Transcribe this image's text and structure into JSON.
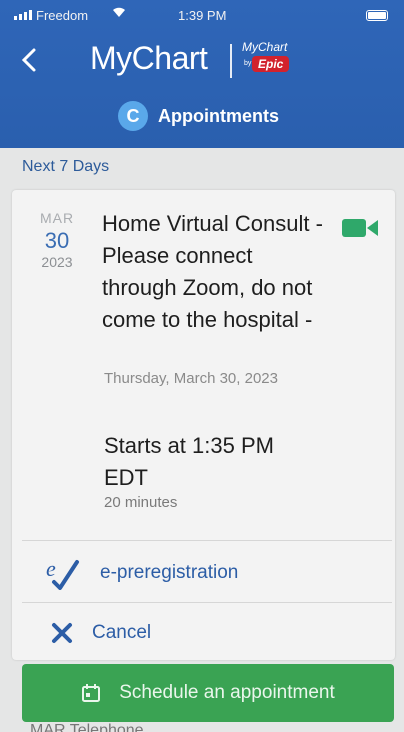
{
  "status_bar": {
    "carrier": "Freedom",
    "time": "1:39 PM"
  },
  "header": {
    "back_icon": "chevron-left-icon",
    "logo_text": "MyChart",
    "badge_mychart": "MyChart",
    "badge_by": "by",
    "badge_epic": "Epic",
    "section_icon_letter": "C",
    "section_title": "Appointments"
  },
  "list": {
    "range_label": "Next 7 Days",
    "appointment": {
      "month": "MAR",
      "day": "30",
      "year": "2023",
      "title": "Home Virtual Consult - Please connect through Zoom, do not come to the hospital -",
      "date_line": "Thursday, March 30, 2023",
      "start_line": "Starts at 1:35 PM EDT",
      "duration": "20 minutes",
      "video_icon": "video-camera-icon",
      "video_icon_color": "#2fa86a"
    },
    "actions": [
      {
        "label": "e-preregistration",
        "icon": "e-checkmark-icon"
      },
      {
        "label": "Cancel",
        "icon": "x-icon"
      }
    ]
  },
  "schedule_button": {
    "label": "Schedule an appointment",
    "icon": "calendar-icon",
    "color": "#3aa353"
  },
  "next_item_peek": "MAR Telephone"
}
